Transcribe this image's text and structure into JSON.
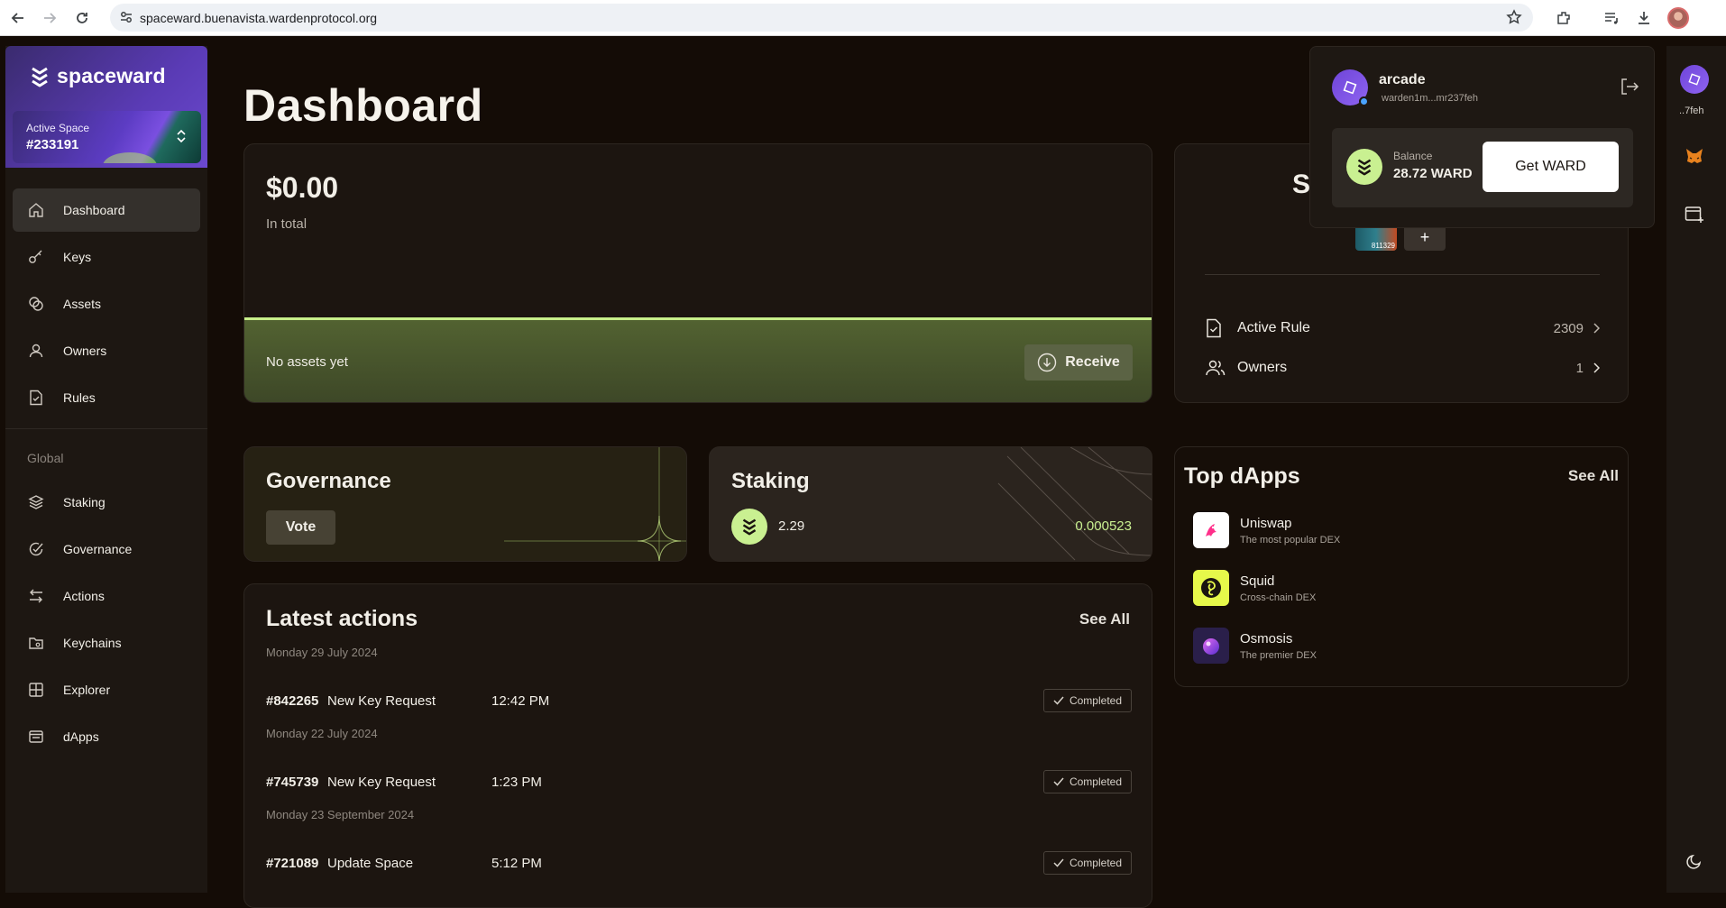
{
  "browser": {
    "url": "spaceward.buenavista.wardenprotocol.org"
  },
  "sidebar": {
    "brand": "spaceward",
    "active_space_label": "Active Space",
    "active_space_value": "#233191",
    "items": [
      {
        "label": "Dashboard",
        "icon": "home-icon",
        "active": true
      },
      {
        "label": "Keys",
        "icon": "key-icon"
      },
      {
        "label": "Assets",
        "icon": "coins-icon"
      },
      {
        "label": "Owners",
        "icon": "user-icon"
      },
      {
        "label": "Rules",
        "icon": "file-check-icon"
      }
    ],
    "global_label": "Global",
    "global_items": [
      {
        "label": "Staking",
        "icon": "layers-icon"
      },
      {
        "label": "Governance",
        "icon": "check-circle-icon"
      },
      {
        "label": "Actions",
        "icon": "arrows-icon"
      },
      {
        "label": "Keychains",
        "icon": "folder-icon"
      },
      {
        "label": "Explorer",
        "icon": "grid-icon"
      },
      {
        "label": "dApps",
        "icon": "window-icon"
      }
    ]
  },
  "main": {
    "title": "Dashboard",
    "total": {
      "amount": "$0.00",
      "caption": "In total",
      "empty_text": "No assets yet",
      "receive_label": "Receive"
    },
    "space": {
      "title_partial": "S",
      "key_avatar_text": "811329",
      "add_label": "+",
      "rows": [
        {
          "label": "Active Rule",
          "value": "2309",
          "icon": "file-check-icon"
        },
        {
          "label": "Owners",
          "value": "1",
          "icon": "users-icon"
        }
      ]
    },
    "governance": {
      "title": "Governance",
      "vote_label": "Vote"
    },
    "staking": {
      "title": "Staking",
      "amount": "2.29",
      "rewards": "0.000523"
    },
    "top_dapps": {
      "title": "Top dApps",
      "see_all": "See All",
      "items": [
        {
          "name": "Uniswap",
          "desc": "The most popular DEX",
          "bg": "#ffffff"
        },
        {
          "name": "Squid",
          "desc": "Cross-chain DEX",
          "bg": "#e6f84a"
        },
        {
          "name": "Osmosis",
          "desc": "The premier DEX",
          "bg": "#2a1f4a"
        }
      ]
    },
    "latest_actions": {
      "title": "Latest actions",
      "see_all": "See All",
      "groups": [
        {
          "date": "Monday 29 July 2024",
          "id": "#842265",
          "name": "New Key Request",
          "time": "12:42 PM",
          "status": "Completed"
        },
        {
          "date": "Monday 22 July 2024",
          "id": "#745739",
          "name": "New Key Request",
          "time": "1:23 PM",
          "status": "Completed"
        },
        {
          "date": "Monday 23 September 2024",
          "id": "#721089",
          "name": "Update Space",
          "time": "5:12 PM",
          "status": "Completed"
        }
      ]
    }
  },
  "popover": {
    "name": "arcade",
    "address": "warden1m...mr237feh",
    "balance_label": "Balance",
    "balance_value": "28.72 WARD",
    "get_ward_label": "Get WARD"
  },
  "rail": {
    "address_short": "..7feh"
  },
  "colors": {
    "accent_green": "#c9f091",
    "brand_purple": "#5a3bb5",
    "background": "#140c06"
  }
}
